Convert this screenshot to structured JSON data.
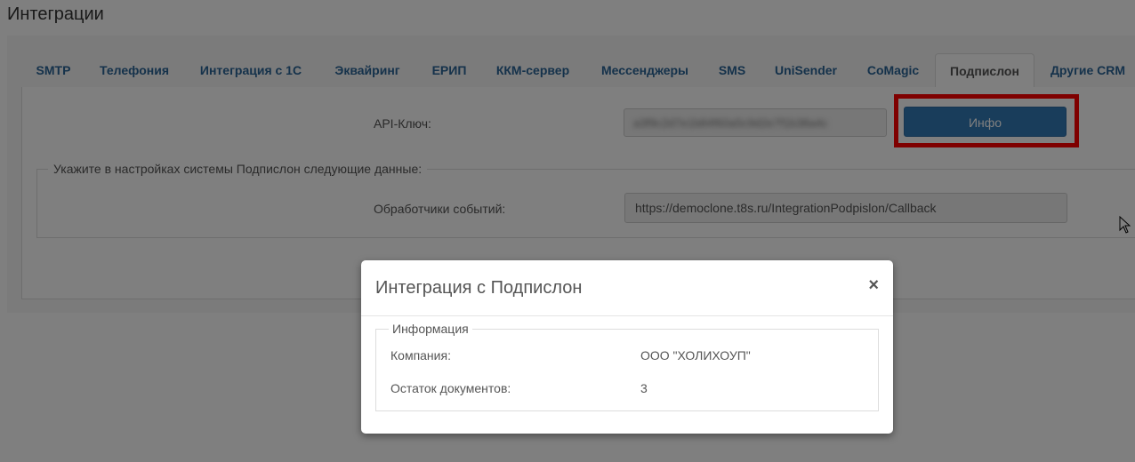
{
  "page": {
    "title": "Интеграции"
  },
  "tabs": [
    {
      "label": "SMTP"
    },
    {
      "label": "Телефония"
    },
    {
      "label": "Интеграция с 1С"
    },
    {
      "label": "Эквайринг"
    },
    {
      "label": "ЕРИП"
    },
    {
      "label": "ККМ-сервер"
    },
    {
      "label": "Мессенджеры"
    },
    {
      "label": "SMS"
    },
    {
      "label": "UniSender"
    },
    {
      "label": "CoMagic"
    },
    {
      "label": "Подпислон",
      "active": true
    },
    {
      "label": "Другие CRM"
    }
  ],
  "form": {
    "api_key_label": "API-Ключ:",
    "api_key_value": "a3f9c2d7e1b84f60a5c9d2e7f1b38a4c",
    "info_button": "Инфо",
    "settings_legend": "Укажите в настройках системы Подпислон следующие данные:",
    "event_handlers_label": "Обработчики событий:",
    "event_handlers_value": "https://democlone.t8s.ru/IntegrationPodpislon/Callback"
  },
  "modal": {
    "title": "Интеграция с Подпислон",
    "close": "×",
    "legend": "Информация",
    "rows": [
      {
        "label": "Компания:",
        "value": "ООО \"ХОЛИХОУП\""
      },
      {
        "label": "Остаток документов:",
        "value": "3"
      }
    ]
  },
  "colors": {
    "link": "#2a6496",
    "primary": "#337ab7",
    "highlight": "#ff0000",
    "overlay": "rgba(0,0,0,0.5)"
  }
}
